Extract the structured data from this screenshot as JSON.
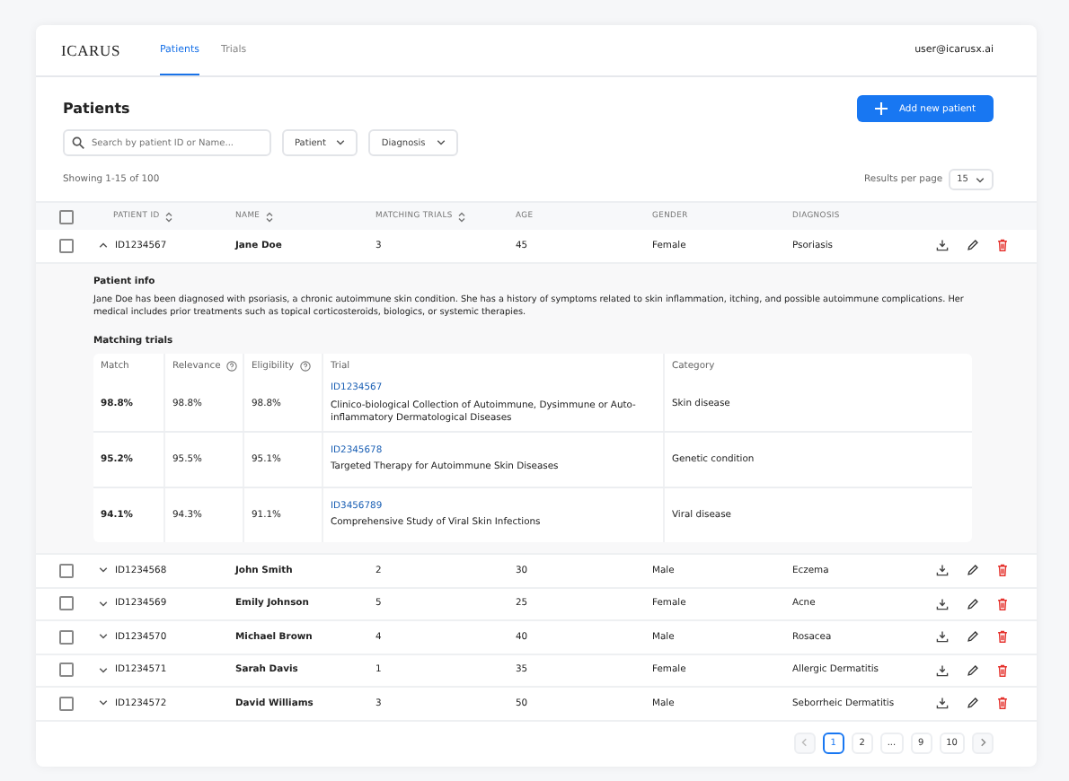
{
  "header": {
    "logo": "ICARUS",
    "nav": [
      {
        "label": "Patients",
        "selected": true
      },
      {
        "label": "Trials",
        "selected": false
      }
    ],
    "user": "user@icarusx.ai"
  },
  "page": {
    "title": "Patients",
    "add_button": "Add new patient",
    "search": {
      "placeholder": "Search by patient ID or Name..."
    },
    "filters": [
      "Patient",
      "Diagnosis"
    ],
    "showing": "Showing 1-15 of 100",
    "per_page_label": "Results per page",
    "per_page": "15"
  },
  "table": {
    "all_checked": false,
    "columns": [
      {
        "label": "PATIENT ID",
        "sortable": true
      },
      {
        "label": "NAME",
        "sortable": true
      },
      {
        "label": "MATCHING TRIALS",
        "sortable": true
      },
      {
        "label": "AGE",
        "sortable": false
      },
      {
        "label": "GENDER",
        "sortable": false
      },
      {
        "label": "DIAGNOSIS",
        "sortable": false
      }
    ],
    "rows": [
      {
        "id": "ID1234567",
        "name": "Jane Doe",
        "trials": "3",
        "age": "45",
        "gender": "Female",
        "diagnosis": "Psoriasis",
        "checked": false,
        "expanded": true,
        "details": {
          "info_title": "Patient info",
          "info": "Jane Doe has been diagnosed with psoriasis, a chronic autoimmune skin condition. She has a history of symptoms related to skin inflammation, itching, and possible autoimmune complications. Her medical includes prior treatments such as topical corticosteroids, biologics, or systemic therapies.",
          "trials_title": "Matching trials",
          "columns": [
            {
              "label": "Match",
              "help": false
            },
            {
              "label": "Relevance",
              "help": true
            },
            {
              "label": "Eligibility",
              "help": true
            },
            {
              "label": "Trial",
              "help": false
            },
            {
              "label": "Category",
              "help": false
            }
          ],
          "trials": [
            {
              "match": "98.8%",
              "relevance": "98.8%",
              "eligibility": "98.8%",
              "id": "ID1234567",
              "title": "Clinico-biological Collection of Autoimmune, Dysimmune or Auto-inflammatory Dermatological Diseases",
              "category": "Skin disease"
            },
            {
              "match": "95.2%",
              "relevance": "95.5%",
              "eligibility": "95.1%",
              "id": "ID2345678",
              "title": "Targeted Therapy for Autoimmune Skin Diseases",
              "category": "Genetic condition"
            },
            {
              "match": "94.1%",
              "relevance": "94.3%",
              "eligibility": "91.1%",
              "id": "ID3456789",
              "title": "Comprehensive Study of Viral Skin Infections",
              "category": "Viral disease"
            }
          ]
        }
      },
      {
        "id": "ID1234568",
        "name": "John Smith",
        "trials": "2",
        "age": "30",
        "gender": "Male",
        "diagnosis": "Eczema",
        "checked": false,
        "expanded": false
      },
      {
        "id": "ID1234569",
        "name": "Emily Johnson",
        "trials": "5",
        "age": "25",
        "gender": "Female",
        "diagnosis": "Acne",
        "checked": false,
        "expanded": false
      },
      {
        "id": "ID1234570",
        "name": "Michael Brown",
        "trials": "4",
        "age": "40",
        "gender": "Male",
        "diagnosis": "Rosacea",
        "checked": false,
        "expanded": false
      },
      {
        "id": "ID1234571",
        "name": "Sarah Davis",
        "trials": "1",
        "age": "35",
        "gender": "Female",
        "diagnosis": "Allergic Dermatitis",
        "checked": false,
        "expanded": false
      },
      {
        "id": "ID1234572",
        "name": "David Williams",
        "trials": "3",
        "age": "50",
        "gender": "Male",
        "diagnosis": "Seborrheic Dermatitis",
        "checked": false,
        "expanded": false
      }
    ]
  },
  "pagination": {
    "pages": [
      {
        "label": "1",
        "selected": true
      },
      {
        "label": "2",
        "selected": false
      },
      {
        "label": "...",
        "selected": false
      },
      {
        "label": "9",
        "selected": false
      },
      {
        "label": "10",
        "selected": false
      }
    ]
  }
}
